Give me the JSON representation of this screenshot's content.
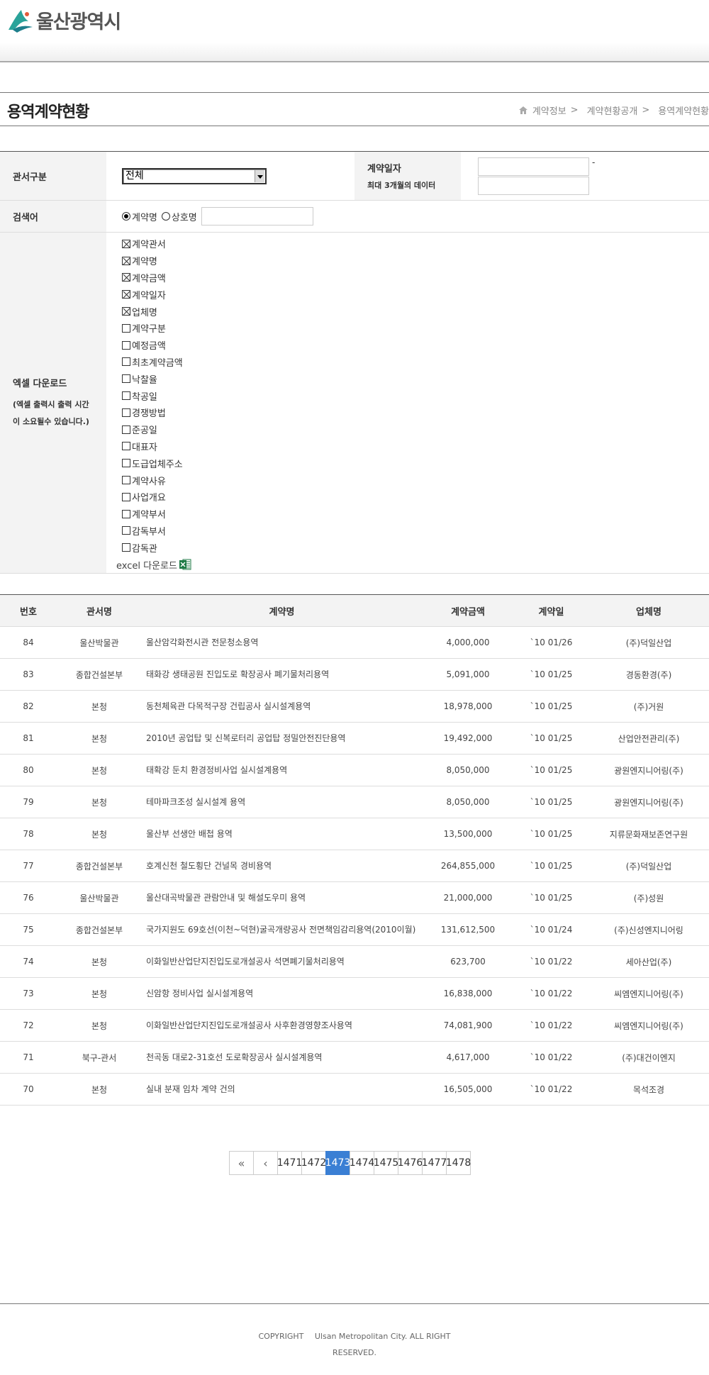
{
  "header": {
    "logo_text": "울산광역시"
  },
  "page": {
    "title": "용역계약현황",
    "breadcrumb": [
      "계약정보",
      "계약현황공개",
      "용역계약현황"
    ],
    "breadcrumb_sep": ">"
  },
  "search": {
    "office_label": "관서구분",
    "office_value": "전체",
    "date_label": "계약일자",
    "date_sub": "최대 3개월의 데이터",
    "date_dash": "-",
    "keyword_label": "검색어",
    "radio_contract": "계약명",
    "radio_company": "상호명",
    "excel_label": "엑셀 다운로드",
    "excel_note1": "(엑셀 출력시 출력 시간",
    "excel_note2": "이 소요될수 있습니다.)",
    "excel_fields": [
      {
        "label": "계약관서",
        "checked": true
      },
      {
        "label": "계약명",
        "checked": true
      },
      {
        "label": "계약금액",
        "checked": true
      },
      {
        "label": "계약일자",
        "checked": true
      },
      {
        "label": "업체명",
        "checked": true
      },
      {
        "label": "계약구분",
        "checked": false
      },
      {
        "label": "예정금액",
        "checked": false
      },
      {
        "label": "최초계약금액",
        "checked": false
      },
      {
        "label": "낙찰율",
        "checked": false
      },
      {
        "label": "착공일",
        "checked": false
      },
      {
        "label": "경쟁방법",
        "checked": false
      },
      {
        "label": "준공일",
        "checked": false
      },
      {
        "label": "대표자",
        "checked": false
      },
      {
        "label": "도급업체주소",
        "checked": false
      },
      {
        "label": "계약사유",
        "checked": false
      },
      {
        "label": "사업개요",
        "checked": false
      },
      {
        "label": "계약부서",
        "checked": false
      },
      {
        "label": "감독부서",
        "checked": false
      },
      {
        "label": "감독관",
        "checked": false
      }
    ],
    "excel_download": "excel 다운로드"
  },
  "table": {
    "headers": [
      "번호",
      "관서명",
      "계약명",
      "계약금액",
      "계약일",
      "업체명"
    ],
    "rows": [
      [
        "84",
        "울산박물관",
        "울산암각화전시관 전문청소용역",
        "4,000,000",
        "`10 01/26",
        "(주)덕일산업"
      ],
      [
        "83",
        "종합건설본부",
        "태화강 생태공원 진입도로 확장공사 폐기물처리용역",
        "5,091,000",
        "`10 01/25",
        "경동환경(주)"
      ],
      [
        "82",
        "본청",
        "동천체육관 다목적구장 건립공사 실시설계용역",
        "18,978,000",
        "`10 01/25",
        "(주)거원"
      ],
      [
        "81",
        "본청",
        "2010년 공업탑 및 신복로터리 공업탑 정밀안전진단용역",
        "19,492,000",
        "`10 01/25",
        "산업안전관리(주)"
      ],
      [
        "80",
        "본청",
        "태확강 둔치 환경정비사업 실시설계용역",
        "8,050,000",
        "`10 01/25",
        "광원엔지니어링(주)"
      ],
      [
        "79",
        "본청",
        "테마파크조성 실시설계 용역",
        "8,050,000",
        "`10 01/25",
        "광원엔지니어링(주)"
      ],
      [
        "78",
        "본청",
        "울산부 선생안 배첩 용역",
        "13,500,000",
        "`10 01/25",
        "지류문화재보존연구원"
      ],
      [
        "77",
        "종합건설본부",
        "호계신천 철도횡단 건널목 경비용역",
        "264,855,000",
        "`10 01/25",
        "(주)덕일산업"
      ],
      [
        "76",
        "울산박물관",
        "울산대곡박물관 관람안내 및 해설도우미 용역",
        "21,000,000",
        "`10 01/25",
        "(주)성원"
      ],
      [
        "75",
        "종합건설본부",
        "국가지원도 69호선(이천~덕현)굴곡개량공사 전면책임감리용역(2010이월)",
        "131,612,500",
        "`10 01/24",
        "(주)신성엔지니어링"
      ],
      [
        "74",
        "본청",
        "이화일반산업단지진입도로개설공사 석면폐기물처리용역",
        "623,700",
        "`10 01/22",
        "세아산업(주)"
      ],
      [
        "73",
        "본청",
        "신암항 정비사업 실시설계용역",
        "16,838,000",
        "`10 01/22",
        "씨엠엔지니어링(주)"
      ],
      [
        "72",
        "본청",
        "이화일반산업단지진입도로개설공사 사후환경영향조사용역",
        "74,081,900",
        "`10 01/22",
        "씨엠엔지니어링(주)"
      ],
      [
        "71",
        "북구-관서",
        "천곡동 대로2-31호선 도로확장공사 실시설계용역",
        "4,617,000",
        "`10 01/22",
        "(주)대건이엔지"
      ],
      [
        "70",
        "본청",
        "실내 분재 임차 계약 건의",
        "16,505,000",
        "`10 01/22",
        "목석조경"
      ]
    ]
  },
  "pagination": {
    "first": "«",
    "prev": "‹",
    "pages": [
      "1471",
      "1472",
      "1473",
      "1474",
      "1475",
      "1476",
      "1477",
      "1478"
    ],
    "active": "1473"
  },
  "footer": {
    "copyright_label": "COPYRIGHT",
    "copyright_line1": "Ulsan Metropolitan City. ALL RIGHT",
    "copyright_line2": "RESERVED."
  },
  "colors": {
    "accent": "#3a7fd4",
    "logo_teal": "#2aa39a"
  }
}
